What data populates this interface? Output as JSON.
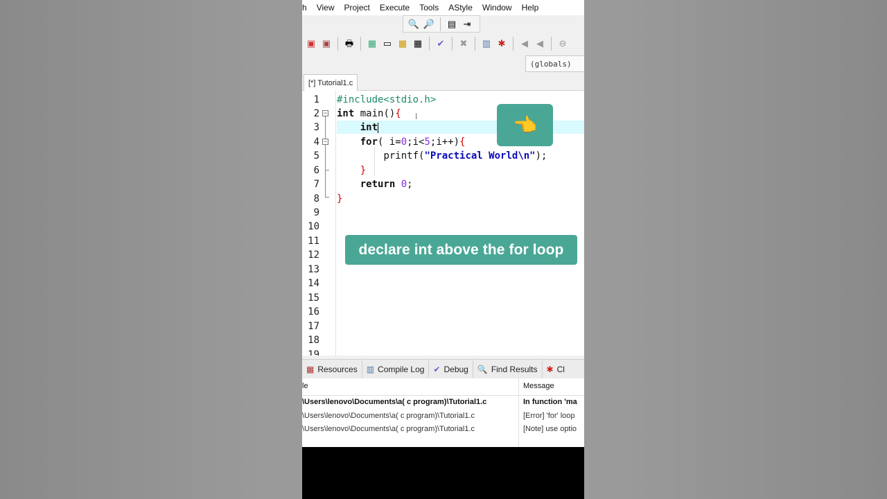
{
  "menu": [
    "h",
    "View",
    "Project",
    "Execute",
    "Tools",
    "AStyle",
    "Window",
    "Help"
  ],
  "toolbar": {
    "globals": "(globals)"
  },
  "editor_tab": "[*] Tutorial1.c",
  "code": {
    "line_numbers": [
      "1",
      "2",
      "3",
      "4",
      "5",
      "6",
      "7",
      "8",
      "9",
      "10",
      "11",
      "12",
      "13",
      "14",
      "15",
      "16",
      "17",
      "18",
      "19"
    ],
    "l1": "#include<stdio.h>",
    "l2_kw": "int",
    "l2_rest": " main()",
    "l2_brace": "{",
    "l3": "int",
    "l4_kw": "for",
    "l4_a": "( ",
    "l4_b": "i=",
    "l4_n1": "0",
    "l4_c": ";i<",
    "l4_n2": "5",
    "l4_d": ";i++)",
    "l4_brace": "{",
    "l5_fn": "printf(",
    "l5_str": "\"Practical World\\n\"",
    "l5_end": ");",
    "l6": "}",
    "l7_kw": "return",
    "l7_num": "0",
    "l7_end": ";",
    "l8": "}"
  },
  "overlay": {
    "hand": "👈",
    "caption": "declare int above the for loop"
  },
  "panel_tabs": [
    "Resources",
    "Compile Log",
    "Debug",
    "Find Results",
    "Cl"
  ],
  "messages": {
    "headers": [
      "le",
      "Message"
    ],
    "rows": [
      {
        "file": "\\Users\\lenovo\\Documents\\a( c program)\\Tutorial1.c",
        "message": "In function 'ma"
      },
      {
        "file": "\\Users\\lenovo\\Documents\\a( c program)\\Tutorial1.c",
        "message": "[Error] 'for' loop"
      },
      {
        "file": "\\Users\\lenovo\\Documents\\a( c program)\\Tutorial1.c",
        "message": "[Note] use optio"
      }
    ]
  }
}
